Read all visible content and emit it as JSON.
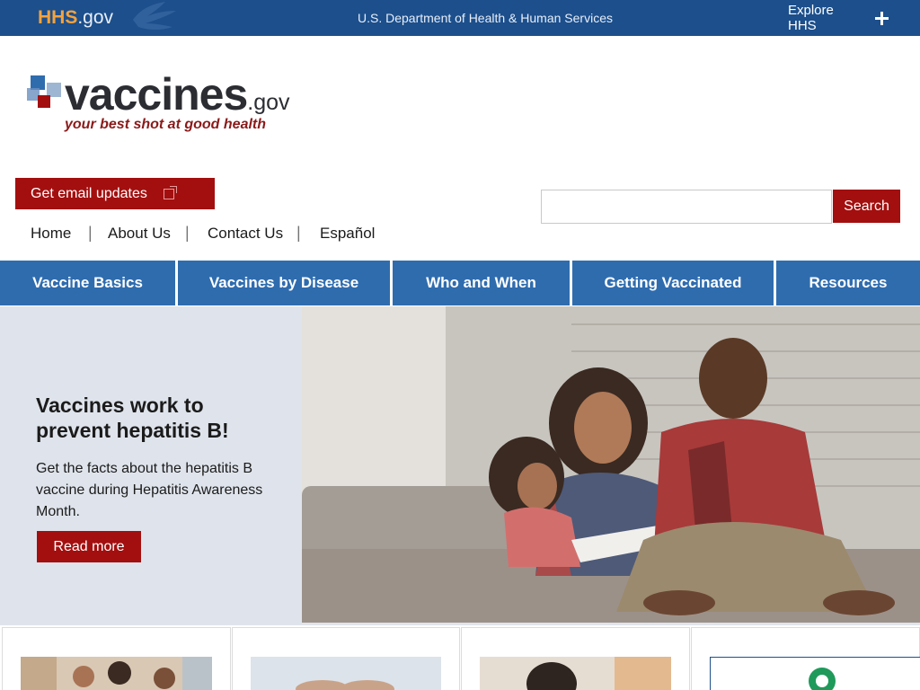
{
  "hhs_bar": {
    "logo_hhs": "HHS",
    "logo_gov": ".gov",
    "department": "U.S. Department of Health & Human Services",
    "explore_label": "Explore HHS"
  },
  "logo": {
    "word": "vaccines",
    "dotgov": ".gov",
    "tagline": "your best shot at good health"
  },
  "email": {
    "label": "Get email updates"
  },
  "search": {
    "placeholder": "",
    "button_label": "Search"
  },
  "utility_nav": [
    {
      "label": "Home"
    },
    {
      "label": "About Us"
    },
    {
      "label": "Contact Us"
    },
    {
      "label": "Español"
    }
  ],
  "main_nav": [
    {
      "label": "Vaccine Basics"
    },
    {
      "label": "Vaccines by Disease"
    },
    {
      "label": "Who and When"
    },
    {
      "label": "Getting Vaccinated"
    },
    {
      "label": "Resources"
    }
  ],
  "hero": {
    "heading": "Vaccines work to prevent hepatitis B!",
    "text": "Get the facts about the hepatitis B vaccine during Hepatitis Awareness Month.",
    "button_label": "Read more"
  },
  "colors": {
    "hhs_blue": "#1c4f8c",
    "nav_blue": "#2f6cae",
    "brand_red": "#a30f0f",
    "hero_bg": "#dfe4ec",
    "hhs_orange": "#f5a23c"
  }
}
